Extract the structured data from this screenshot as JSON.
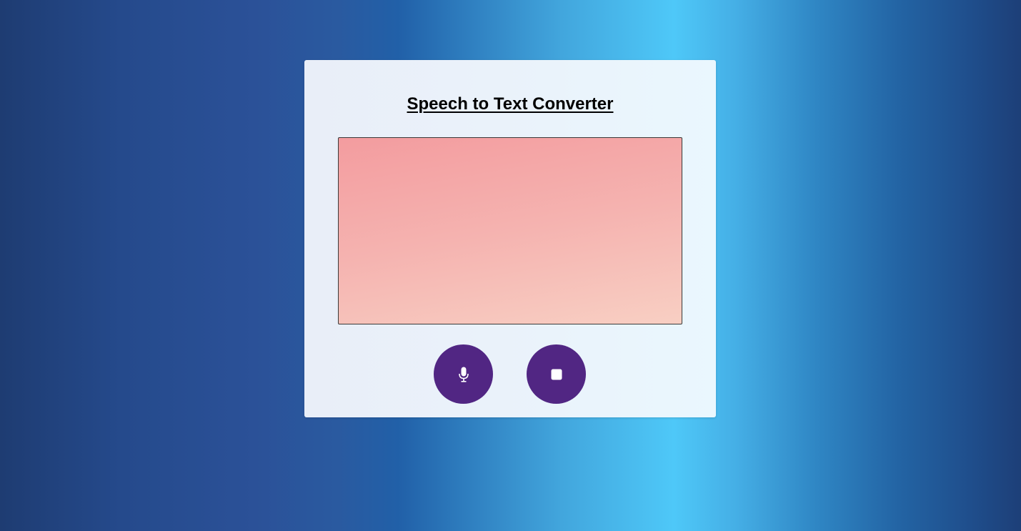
{
  "header": {
    "title": "Speech to Text Converter"
  },
  "transcript": {
    "value": "",
    "placeholder": ""
  },
  "controls": {
    "start_icon": "microphone-icon",
    "stop_icon": "stop-icon"
  },
  "colors": {
    "background_dark": "#1e3c72",
    "background_light": "#4ec8f8",
    "card_background": "#eaf3fb",
    "textarea_top": "#f39c9f",
    "textarea_bottom": "#f8cfc3",
    "button_purple": "#512683",
    "icon_white": "#ffffff"
  }
}
